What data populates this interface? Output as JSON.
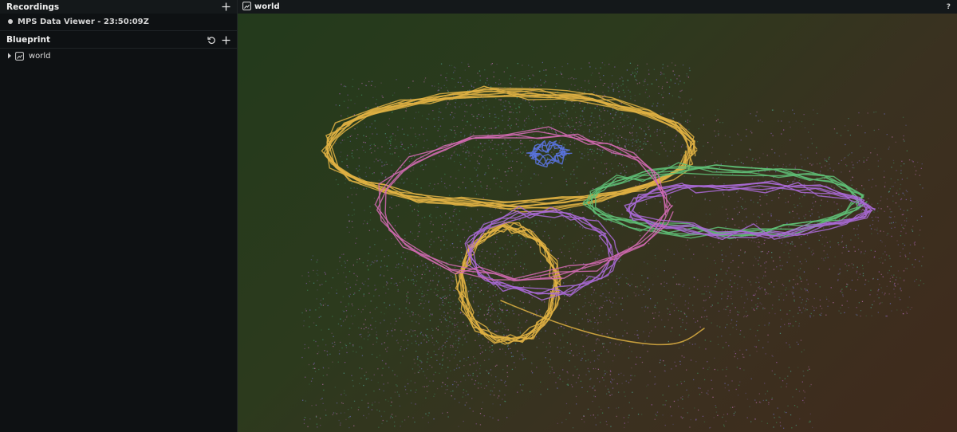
{
  "recordings": {
    "heading": "Recordings",
    "add_icon": "plus-icon",
    "items": [
      {
        "label": "MPS Data Viewer - 23:50:09Z"
      }
    ]
  },
  "blueprint": {
    "heading": "Blueprint",
    "reset_icon": "reset-icon",
    "add_icon": "plus-icon",
    "tree": [
      {
        "label": "world",
        "icon": "3d-view-icon",
        "expanded": false
      }
    ]
  },
  "viewport": {
    "title": "world",
    "help": "?"
  },
  "colors": {
    "trajectory_yellow": "#e0b143",
    "trajectory_purple": "#a96ad6",
    "trajectory_blue": "#5a74e2",
    "trajectory_green": "#5fbf77",
    "trajectory_pink": "#d36bb4",
    "points_purple": "#9a5aa8",
    "points_green": "#3f8a5a"
  }
}
